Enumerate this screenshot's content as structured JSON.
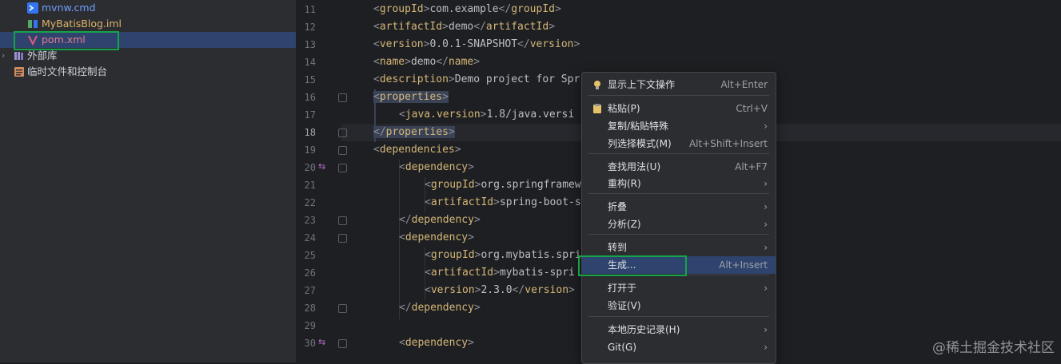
{
  "project_tree": {
    "items": [
      {
        "label": "mvnw.cmd",
        "icon": "terminal-icon",
        "color": "#3574f0"
      },
      {
        "label": "MyBatisBlog.iml",
        "icon": "module-icon",
        "color": "#55a76a"
      },
      {
        "label": "pom.xml",
        "icon": "maven-icon",
        "color": "#e05c7a",
        "selected": true
      },
      {
        "label": "外部库",
        "icon": "library-icon",
        "color": "#9b8fd6",
        "expandable": true
      },
      {
        "label": "临时文件和控制台",
        "icon": "scratch-icon",
        "color": "#d08a5e"
      }
    ]
  },
  "editor": {
    "lines": [
      {
        "num": "11",
        "code": "<groupId>com.example</groupId>"
      },
      {
        "num": "12",
        "code": "<artifactId>demo</artifactId>"
      },
      {
        "num": "13",
        "code": "<version>0.0.1-SNAPSHOT</version>"
      },
      {
        "num": "14",
        "code": "<name>demo</name>"
      },
      {
        "num": "15",
        "code": "<description>Demo project for Spr"
      },
      {
        "num": "16",
        "code": "<properties>"
      },
      {
        "num": "17",
        "code": "<java.version>1.8</java.versi"
      },
      {
        "num": "18",
        "code": "</properties>"
      },
      {
        "num": "19",
        "code": "<dependencies>"
      },
      {
        "num": "20",
        "code": "<dependency>"
      },
      {
        "num": "21",
        "code": "<groupId>org.springframew"
      },
      {
        "num": "22",
        "code": "<artifactId>spring-boot-s"
      },
      {
        "num": "23",
        "code": "</dependency>"
      },
      {
        "num": "24",
        "code": "<dependency>"
      },
      {
        "num": "25",
        "code": "<groupId>org.mybatis.spri"
      },
      {
        "num": "26",
        "code": "<artifactId>mybatis-spri"
      },
      {
        "num": "27",
        "code": "<version>2.3.0</version>"
      },
      {
        "num": "28",
        "code": "</dependency>"
      },
      {
        "num": "29",
        "code": ""
      },
      {
        "num": "30",
        "code": "<dependency>"
      }
    ]
  },
  "context_menu": {
    "items": [
      {
        "label": "显示上下文操作",
        "shortcut": "Alt+Enter",
        "icon": "lightbulb-icon"
      },
      {
        "label": "粘贴(P)",
        "shortcut": "Ctrl+V",
        "icon": "clipboard-icon"
      },
      {
        "label": "复制/粘贴特殊",
        "submenu": true
      },
      {
        "label": "列选择模式(M)",
        "shortcut": "Alt+Shift+Insert"
      },
      {
        "label": "查找用法(U)",
        "shortcut": "Alt+F7"
      },
      {
        "label": "重构(R)",
        "submenu": true
      },
      {
        "label": "折叠",
        "submenu": true
      },
      {
        "label": "分析(Z)",
        "submenu": true
      },
      {
        "label": "转到",
        "submenu": true
      },
      {
        "label": "生成...",
        "shortcut": "Alt+Insert",
        "highlighted": true
      },
      {
        "label": "打开于",
        "submenu": true
      },
      {
        "label": "验证(V)"
      },
      {
        "label": "本地历史记录(H)",
        "submenu": true
      },
      {
        "label": "Git(G)",
        "submenu": true
      }
    ]
  },
  "watermark": "@稀土掘金技术社区",
  "colors": {
    "highlight_box": "#16a34a",
    "selection": "#2e436e",
    "tag": "#d5b778"
  }
}
